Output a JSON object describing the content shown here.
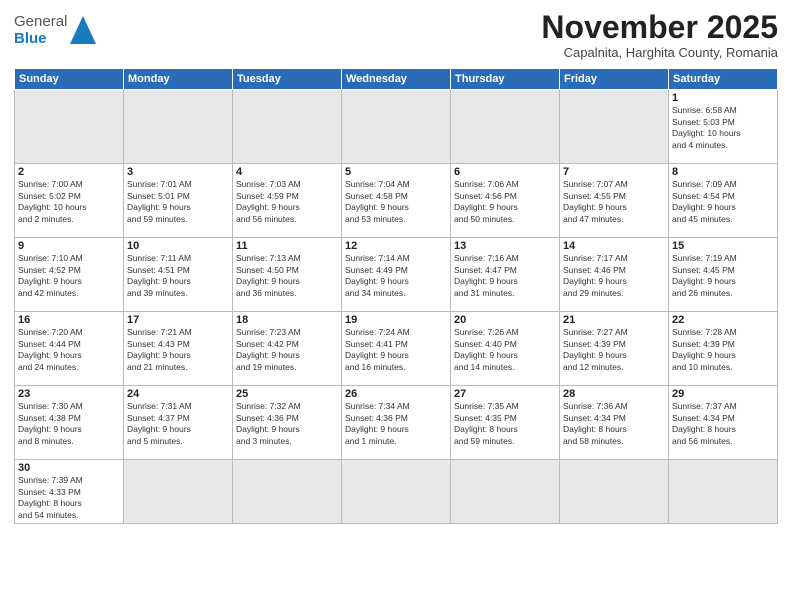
{
  "header": {
    "logo_line1": "General",
    "logo_line2": "Blue",
    "month": "November 2025",
    "location": "Capalnita, Harghita County, Romania"
  },
  "days_of_week": [
    "Sunday",
    "Monday",
    "Tuesday",
    "Wednesday",
    "Thursday",
    "Friday",
    "Saturday"
  ],
  "weeks": [
    [
      {
        "num": "",
        "info": ""
      },
      {
        "num": "",
        "info": ""
      },
      {
        "num": "",
        "info": ""
      },
      {
        "num": "",
        "info": ""
      },
      {
        "num": "",
        "info": ""
      },
      {
        "num": "",
        "info": ""
      },
      {
        "num": "1",
        "info": "Sunrise: 6:58 AM\nSunset: 5:03 PM\nDaylight: 10 hours\nand 4 minutes."
      }
    ],
    [
      {
        "num": "2",
        "info": "Sunrise: 7:00 AM\nSunset: 5:02 PM\nDaylight: 10 hours\nand 2 minutes."
      },
      {
        "num": "3",
        "info": "Sunrise: 7:01 AM\nSunset: 5:01 PM\nDaylight: 9 hours\nand 59 minutes."
      },
      {
        "num": "4",
        "info": "Sunrise: 7:03 AM\nSunset: 4:59 PM\nDaylight: 9 hours\nand 56 minutes."
      },
      {
        "num": "5",
        "info": "Sunrise: 7:04 AM\nSunset: 4:58 PM\nDaylight: 9 hours\nand 53 minutes."
      },
      {
        "num": "6",
        "info": "Sunrise: 7:06 AM\nSunset: 4:56 PM\nDaylight: 9 hours\nand 50 minutes."
      },
      {
        "num": "7",
        "info": "Sunrise: 7:07 AM\nSunset: 4:55 PM\nDaylight: 9 hours\nand 47 minutes."
      },
      {
        "num": "8",
        "info": "Sunrise: 7:09 AM\nSunset: 4:54 PM\nDaylight: 9 hours\nand 45 minutes."
      }
    ],
    [
      {
        "num": "9",
        "info": "Sunrise: 7:10 AM\nSunset: 4:52 PM\nDaylight: 9 hours\nand 42 minutes."
      },
      {
        "num": "10",
        "info": "Sunrise: 7:11 AM\nSunset: 4:51 PM\nDaylight: 9 hours\nand 39 minutes."
      },
      {
        "num": "11",
        "info": "Sunrise: 7:13 AM\nSunset: 4:50 PM\nDaylight: 9 hours\nand 36 minutes."
      },
      {
        "num": "12",
        "info": "Sunrise: 7:14 AM\nSunset: 4:49 PM\nDaylight: 9 hours\nand 34 minutes."
      },
      {
        "num": "13",
        "info": "Sunrise: 7:16 AM\nSunset: 4:47 PM\nDaylight: 9 hours\nand 31 minutes."
      },
      {
        "num": "14",
        "info": "Sunrise: 7:17 AM\nSunset: 4:46 PM\nDaylight: 9 hours\nand 29 minutes."
      },
      {
        "num": "15",
        "info": "Sunrise: 7:19 AM\nSunset: 4:45 PM\nDaylight: 9 hours\nand 26 minutes."
      }
    ],
    [
      {
        "num": "16",
        "info": "Sunrise: 7:20 AM\nSunset: 4:44 PM\nDaylight: 9 hours\nand 24 minutes."
      },
      {
        "num": "17",
        "info": "Sunrise: 7:21 AM\nSunset: 4:43 PM\nDaylight: 9 hours\nand 21 minutes."
      },
      {
        "num": "18",
        "info": "Sunrise: 7:23 AM\nSunset: 4:42 PM\nDaylight: 9 hours\nand 19 minutes."
      },
      {
        "num": "19",
        "info": "Sunrise: 7:24 AM\nSunset: 4:41 PM\nDaylight: 9 hours\nand 16 minutes."
      },
      {
        "num": "20",
        "info": "Sunrise: 7:26 AM\nSunset: 4:40 PM\nDaylight: 9 hours\nand 14 minutes."
      },
      {
        "num": "21",
        "info": "Sunrise: 7:27 AM\nSunset: 4:39 PM\nDaylight: 9 hours\nand 12 minutes."
      },
      {
        "num": "22",
        "info": "Sunrise: 7:28 AM\nSunset: 4:39 PM\nDaylight: 9 hours\nand 10 minutes."
      }
    ],
    [
      {
        "num": "23",
        "info": "Sunrise: 7:30 AM\nSunset: 4:38 PM\nDaylight: 9 hours\nand 8 minutes."
      },
      {
        "num": "24",
        "info": "Sunrise: 7:31 AM\nSunset: 4:37 PM\nDaylight: 9 hours\nand 5 minutes."
      },
      {
        "num": "25",
        "info": "Sunrise: 7:32 AM\nSunset: 4:36 PM\nDaylight: 9 hours\nand 3 minutes."
      },
      {
        "num": "26",
        "info": "Sunrise: 7:34 AM\nSunset: 4:36 PM\nDaylight: 9 hours\nand 1 minute."
      },
      {
        "num": "27",
        "info": "Sunrise: 7:35 AM\nSunset: 4:35 PM\nDaylight: 8 hours\nand 59 minutes."
      },
      {
        "num": "28",
        "info": "Sunrise: 7:36 AM\nSunset: 4:34 PM\nDaylight: 8 hours\nand 58 minutes."
      },
      {
        "num": "29",
        "info": "Sunrise: 7:37 AM\nSunset: 4:34 PM\nDaylight: 8 hours\nand 56 minutes."
      }
    ],
    [
      {
        "num": "30",
        "info": "Sunrise: 7:39 AM\nSunset: 4:33 PM\nDaylight: 8 hours\nand 54 minutes."
      },
      {
        "num": "",
        "info": ""
      },
      {
        "num": "",
        "info": ""
      },
      {
        "num": "",
        "info": ""
      },
      {
        "num": "",
        "info": ""
      },
      {
        "num": "",
        "info": ""
      },
      {
        "num": "",
        "info": ""
      }
    ]
  ]
}
